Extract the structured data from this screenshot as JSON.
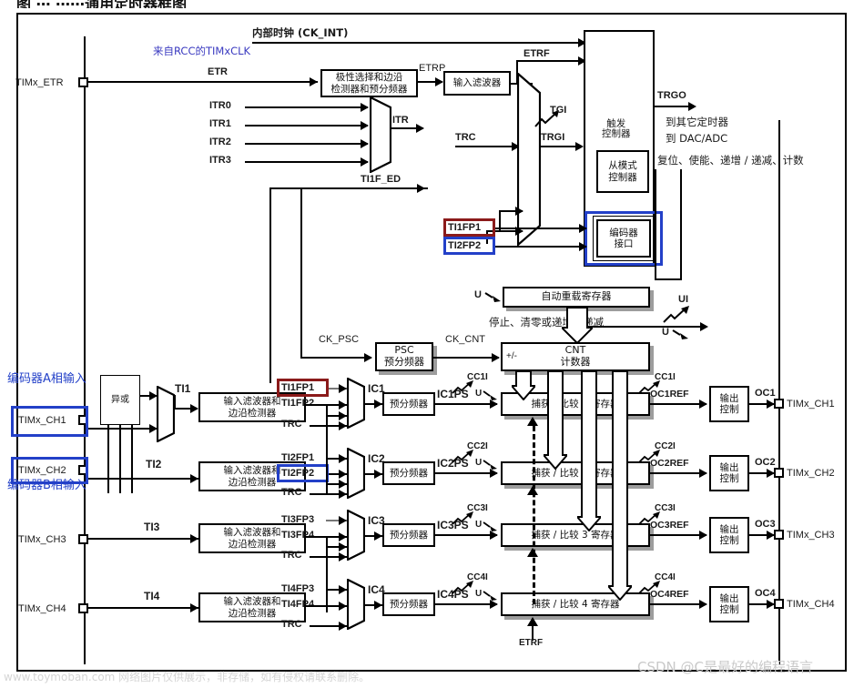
{
  "figure": {
    "title_fragment": "图  ⋯    ⋯⋯通用定时器框图",
    "watermark_right": "CSDN @C是最好的编程语言",
    "watermark_left": "www.toymoban.com 网络图片仅供展示，非存储，如有侵权请联系删除。"
  },
  "colors": {
    "highlight_blue": "#2340c8",
    "highlight_red": "#8b1a1a",
    "line": "#000000",
    "shadow": "#9d9d9d",
    "watermark": "#c9c9c9"
  },
  "top_section": {
    "internal_clock": "内部时钟 (CK_INT)",
    "from_rcc": "来自RCC的TIMxCLK",
    "etr_pin": "TIMx_ETR",
    "etr_label": "ETR",
    "polarity_block": "极性选择和边沿\n检测器和预分频器",
    "etrp_label": "ETRP",
    "input_filter_block": "输入滤波器",
    "etrf_label": "ETRF",
    "itr_inputs": [
      "ITR0",
      "ITR1",
      "ITR2",
      "ITR3"
    ],
    "itr_label": "ITR",
    "trc_label": "TRC",
    "ti1f_ed_label": "TI1F_ED",
    "tgi_label": "TGI",
    "trgi_label": "TRGI",
    "trigger_controller": "触发\n控制器",
    "slave_mode_controller": "从模式\n控制器",
    "encoder_interface": "编码器\n接口",
    "trgo_label": "TRGO",
    "to_other_timers": "到其它定时器",
    "to_dac_adc": "到 DAC/ADC",
    "slave_outputs": "复位、使能、递增 / 递减、计数",
    "ti1fp1_hl": "TI1FP1",
    "ti2fp2_hl": "TI2FP2"
  },
  "counter_section": {
    "auto_reload": "自动重载寄存器",
    "u_flag": "U",
    "ui_flag": "UI",
    "stop_clear": "停止、清零或递增 / 递减",
    "ck_psc": "CK_PSC",
    "psc_block": "PSC\n预分频器",
    "ck_cnt": "CK_CNT",
    "cnt_block": "CNT\n计数器",
    "cnt_sign": "+/-"
  },
  "encoder_notes": {
    "phase_a": "编码器A相输入",
    "phase_b": "编码器B相输入",
    "xor_block": "异或"
  },
  "channels": [
    {
      "pin": "TIMx_CH1",
      "ti": "TI1",
      "filter_block": "输入滤波器和\n边沿检测器",
      "fp_a": "TI1FP1",
      "fp_b": "TI1FP2",
      "trc": "TRC",
      "ic": "IC1",
      "prescaler": "预分频器",
      "icps": "IC1PS",
      "cc_flag": "CC1I",
      "u_flag": "U",
      "ccr": "捕获 / 比较 1 寄存器",
      "cc_out_flag": "CC1I",
      "ocref": "OC1REF",
      "output_control": "输出\n控制",
      "oc": "OC1",
      "out_pin": "TIMx_CH1",
      "fp_a_highlight": "red",
      "fp_b_highlight": "none",
      "pin_highlight": "blue"
    },
    {
      "pin": "TIMx_CH2",
      "ti": "TI2",
      "filter_block": "输入滤波器和\n边沿检测器",
      "fp_a": "TI2FP1",
      "fp_b": "TI2FP2",
      "trc": "TRC",
      "ic": "IC2",
      "prescaler": "预分频器",
      "icps": "IC2PS",
      "cc_flag": "CC2I",
      "u_flag": "U",
      "ccr": "捕获 / 比较 2 寄存器",
      "cc_out_flag": "CC2I",
      "ocref": "OC2REF",
      "output_control": "输出\n控制",
      "oc": "OC2",
      "out_pin": "TIMx_CH2",
      "fp_a_highlight": "none",
      "fp_b_highlight": "blue",
      "pin_highlight": "blue"
    },
    {
      "pin": "TIMx_CH3",
      "ti": "TI3",
      "filter_block": "输入滤波器和\n边沿检测器",
      "fp_a": "TI3FP3",
      "fp_b": "TI3FP4",
      "trc": "TRC",
      "ic": "IC3",
      "prescaler": "预分频器",
      "icps": "IC3PS",
      "cc_flag": "CC3I",
      "u_flag": "U",
      "ccr": "捕获 / 比较 3 寄存器",
      "cc_out_flag": "CC3I",
      "ocref": "OC3REF",
      "output_control": "输出\n控制",
      "oc": "OC3",
      "out_pin": "TIMx_CH3",
      "fp_a_highlight": "none",
      "fp_b_highlight": "none",
      "pin_highlight": "none"
    },
    {
      "pin": "TIMx_CH4",
      "ti": "TI4",
      "filter_block": "输入滤波器和\n边沿检测器",
      "fp_a": "TI4FP3",
      "fp_b": "TI4FP4",
      "trc": "TRC",
      "ic": "IC4",
      "prescaler": "预分频器",
      "icps": "IC4PS",
      "cc_flag": "CC4I",
      "u_flag": "U",
      "ccr": "捕获 / 比较 4 寄存器",
      "cc_out_flag": "CC4I",
      "ocref": "OC4REF",
      "output_control": "输出\n控制",
      "oc": "OC4",
      "out_pin": "TIMx_CH4",
      "fp_a_highlight": "none",
      "fp_b_highlight": "none",
      "pin_highlight": "none"
    }
  ],
  "misc": {
    "etrf_bottom": "ETRF"
  }
}
